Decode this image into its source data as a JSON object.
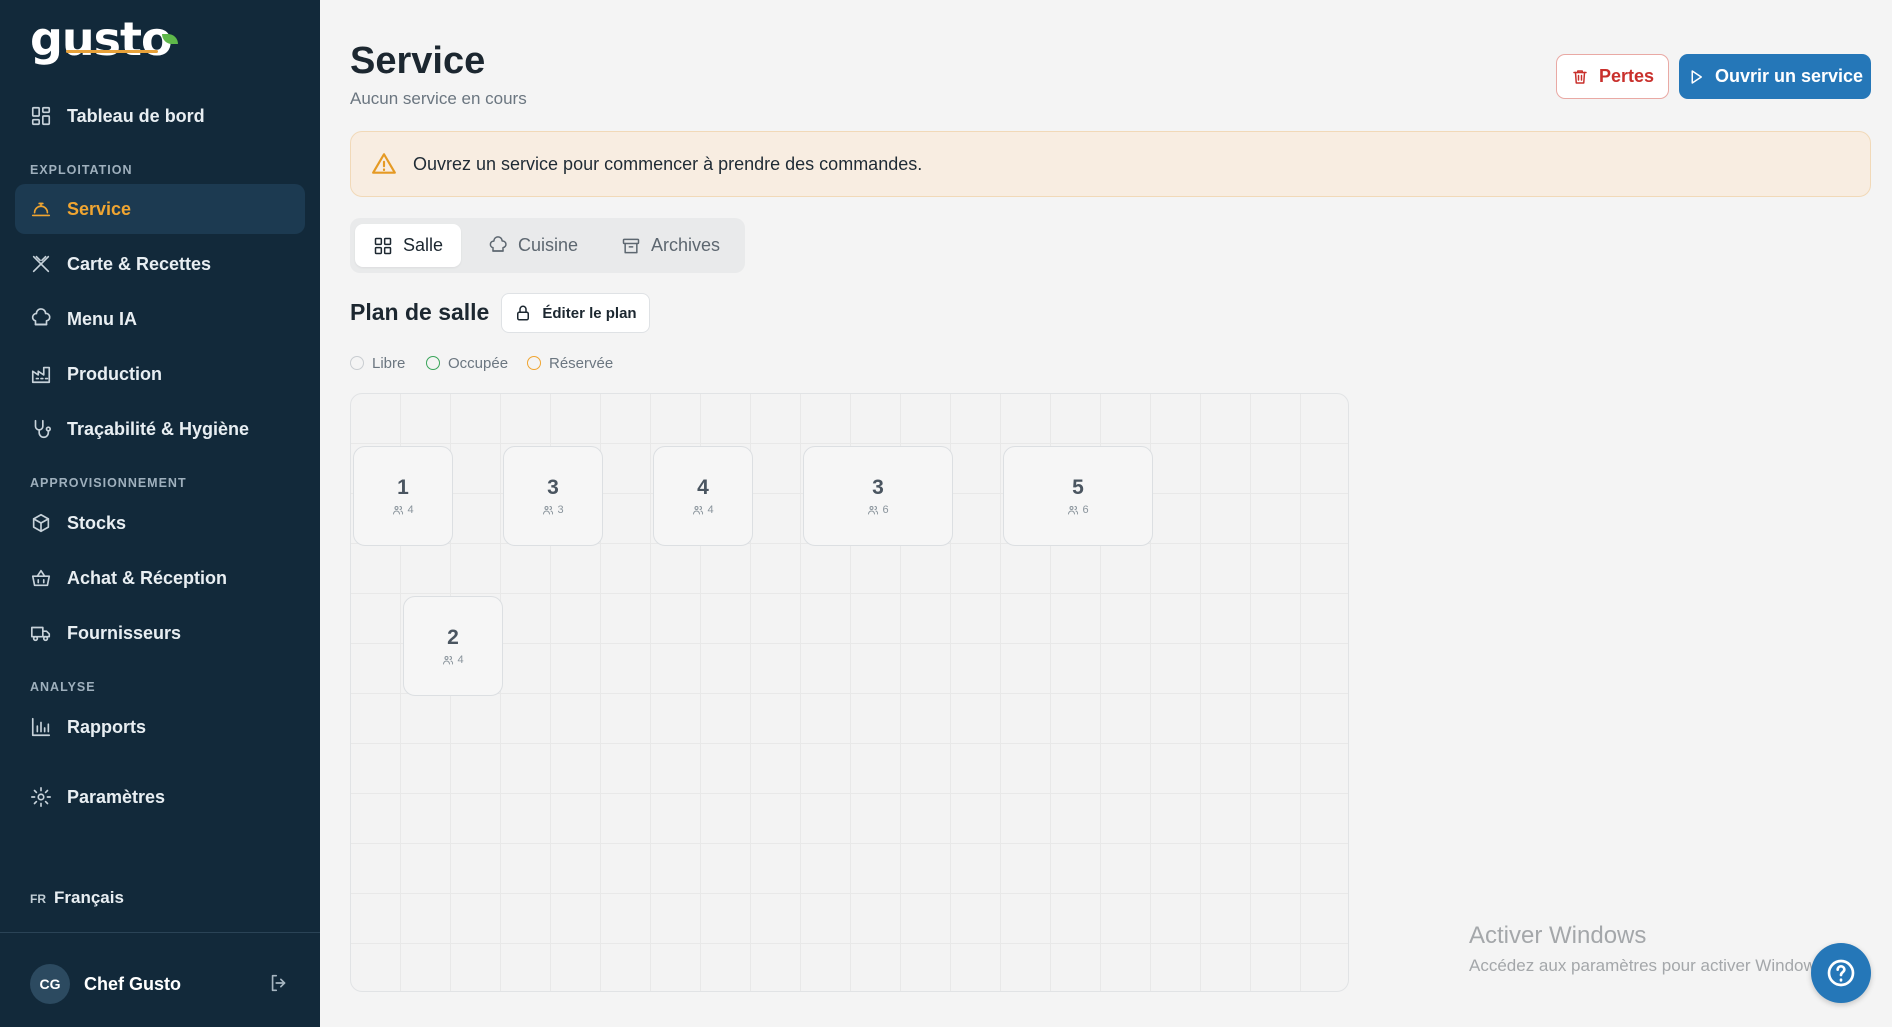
{
  "brand": {
    "name": "gusto",
    "accent": "#f0a531",
    "sidebar_bg": "#12293a",
    "primary": "#2577b8",
    "danger": "#c9302c"
  },
  "sidebar": {
    "dashboard": {
      "label": "Tableau de bord",
      "icon": "dashboard-grid-icon"
    },
    "sections": {
      "exploitation": "EXPLOITATION",
      "approvisionnement": "APPROVISIONNEMENT",
      "analyse": "ANALYSE"
    },
    "items": [
      {
        "label": "Service",
        "icon": "cloche-icon",
        "active": true
      },
      {
        "label": "Carte & Recettes",
        "icon": "utensils-icon"
      },
      {
        "label": "Menu IA",
        "icon": "chef-hat-icon"
      },
      {
        "label": "Production",
        "icon": "factory-icon"
      },
      {
        "label": "Traçabilité & Hygiène",
        "icon": "stethoscope-icon"
      },
      {
        "label": "Stocks",
        "icon": "package-icon"
      },
      {
        "label": "Achat & Réception",
        "icon": "basket-icon"
      },
      {
        "label": "Fournisseurs",
        "icon": "truck-icon"
      },
      {
        "label": "Rapports",
        "icon": "bar-chart-icon"
      },
      {
        "label": "Paramètres",
        "icon": "gear-icon"
      }
    ],
    "language": {
      "code": "FR",
      "name": "Français"
    },
    "user": {
      "initials": "CG",
      "name": "Chef Gusto"
    }
  },
  "header": {
    "title": "Service",
    "subtitle": "Aucun service en cours",
    "pertes_label": "Pertes",
    "open_label": "Ouvrir un service"
  },
  "alert": {
    "text": "Ouvrez un service pour commencer à prendre des commandes.",
    "icon": "warning-triangle-icon"
  },
  "tabs": [
    {
      "label": "Salle",
      "icon": "grid-icon",
      "active": true
    },
    {
      "label": "Cuisine",
      "icon": "chef-hat-icon"
    },
    {
      "label": "Archives",
      "icon": "archive-icon"
    }
  ],
  "plan": {
    "title": "Plan de salle",
    "edit_label": "Éditer le plan",
    "legend": [
      {
        "label": "Libre",
        "color": "#c9cdd1"
      },
      {
        "label": "Occupée",
        "color": "#3aa55a"
      },
      {
        "label": "Réservée",
        "color": "#f0a531"
      }
    ],
    "tables": [
      {
        "number": "1",
        "seats": "4"
      },
      {
        "number": "3",
        "seats": "3"
      },
      {
        "number": "4",
        "seats": "4"
      },
      {
        "number": "3",
        "seats": "6"
      },
      {
        "number": "5",
        "seats": "6"
      },
      {
        "number": "2",
        "seats": "4"
      }
    ]
  },
  "watermark": {
    "title": "Activer Windows",
    "subtitle": "Accédez aux paramètres pour activer Windows."
  }
}
